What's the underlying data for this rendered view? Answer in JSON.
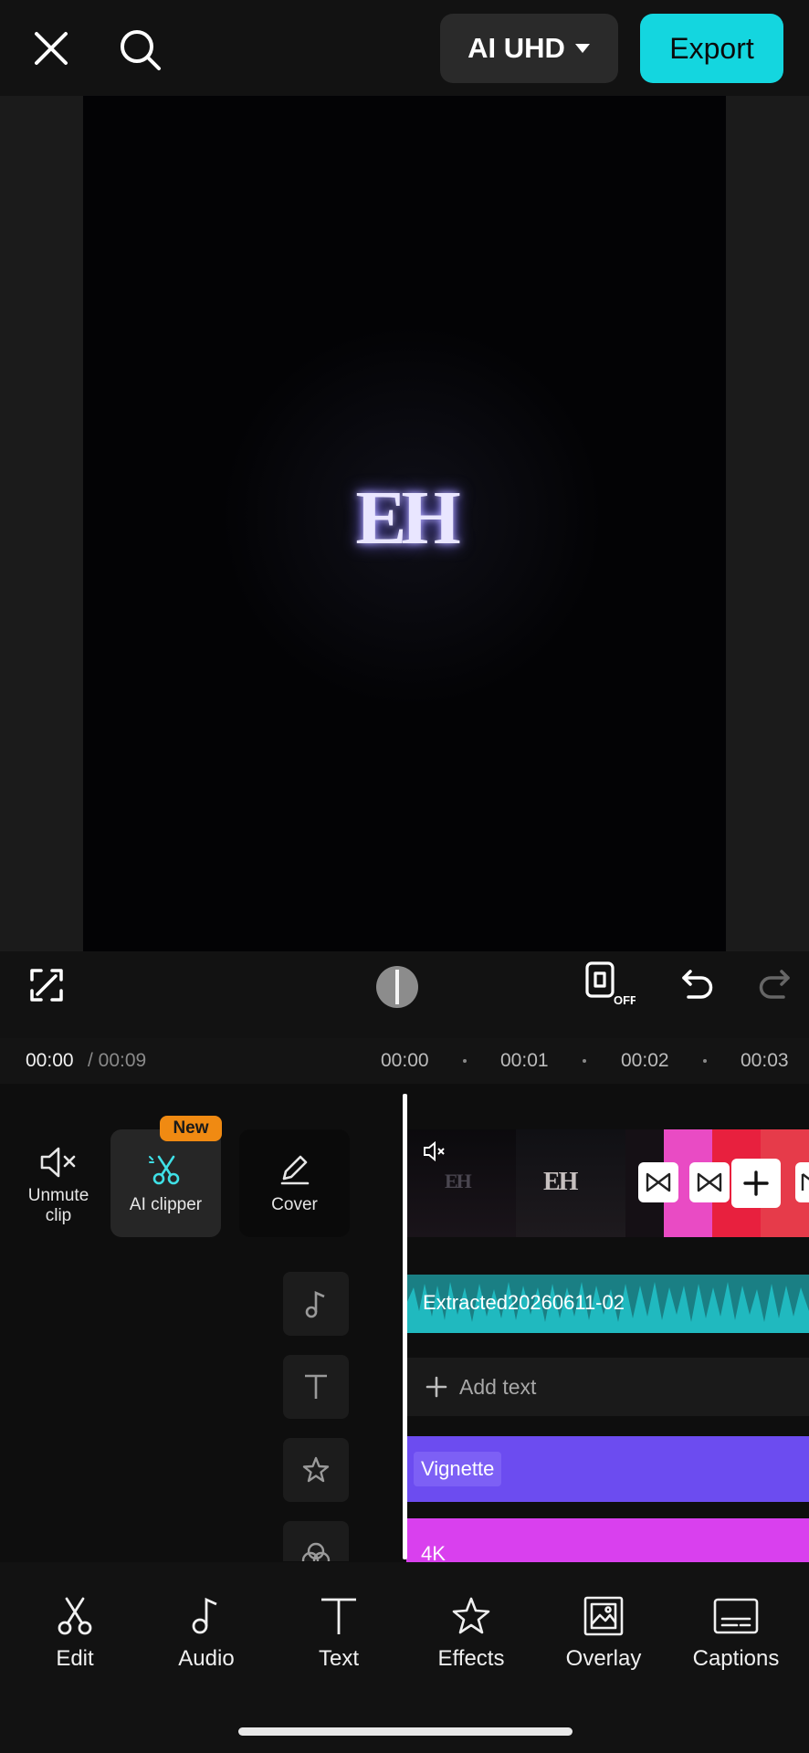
{
  "top_bar": {
    "quality_label": "AI UHD",
    "export_label": "Export"
  },
  "preview": {
    "logo_text": "EH"
  },
  "time": {
    "current": "00:00",
    "total": "/ 00:09",
    "ruler": [
      "00:00",
      "00:01",
      "00:02",
      "00:03"
    ]
  },
  "tools": {
    "unmute_label_line1": "Unmute",
    "unmute_label_line2": "clip",
    "ai_clipper_label": "AI clipper",
    "new_badge": "New",
    "cover_label": "Cover"
  },
  "tracks": {
    "audio_clip": "Extracted20260611-02",
    "add_text": "Add text",
    "effect_clip": "Vignette",
    "filter_clip": "4K"
  },
  "bottom_nav": {
    "items": [
      {
        "label": "Edit",
        "icon": "scissors-icon"
      },
      {
        "label": "Audio",
        "icon": "music-note-icon"
      },
      {
        "label": "Text",
        "icon": "text-icon"
      },
      {
        "label": "Effects",
        "icon": "effects-star-icon"
      },
      {
        "label": "Overlay",
        "icon": "overlay-icon"
      },
      {
        "label": "Captions",
        "icon": "captions-icon"
      }
    ]
  },
  "colors": {
    "accent": "#14d6df",
    "audio_track": "#1a7f84",
    "effect_track": "#6c4cf0",
    "filter_track": "#d940ee",
    "new_badge": "#f08a12"
  }
}
